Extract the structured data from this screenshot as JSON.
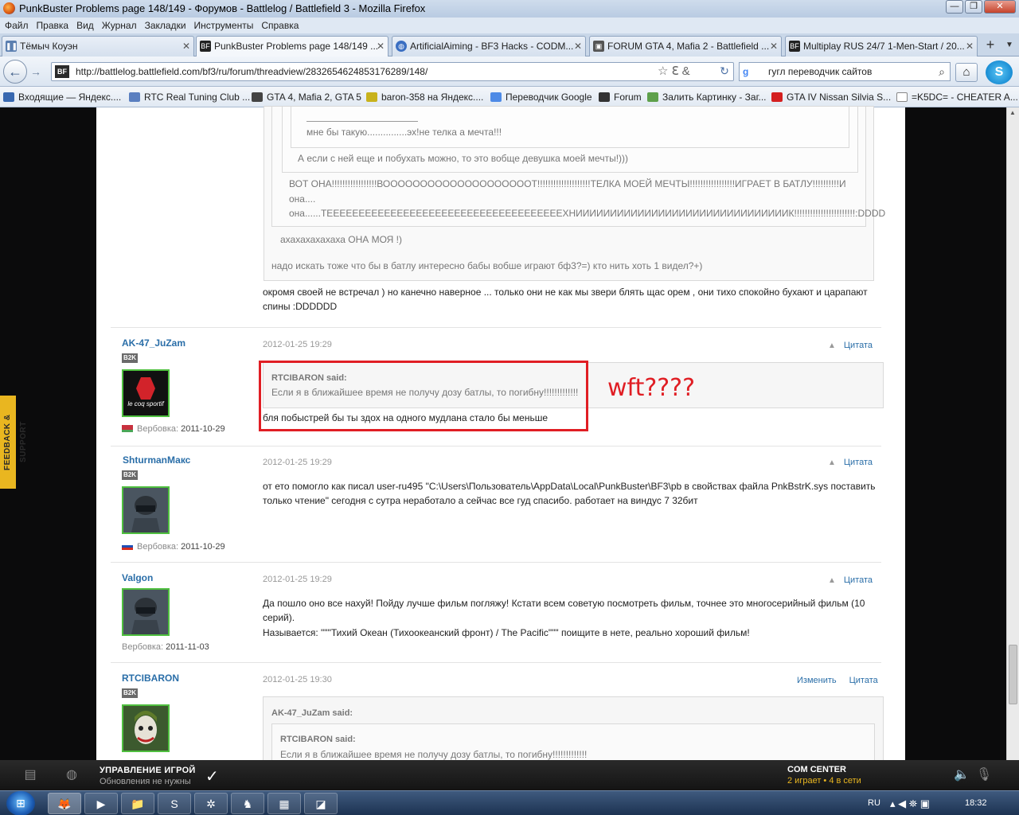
{
  "window": {
    "title": "PunkBuster Problems page 148/149 - Форумов - Battlelog / Battlefield 3 - Mozilla Firefox"
  },
  "menu": [
    "Файл",
    "Правка",
    "Вид",
    "Журнал",
    "Закладки",
    "Инструменты",
    "Справка"
  ],
  "tabs": [
    {
      "label": "Тёмыч Коуэн",
      "icon": "pause-icon"
    },
    {
      "label": "PunkBuster Problems page 148/149 ...",
      "icon": "bf-icon"
    },
    {
      "label": "ArtificialAiming - BF3 Hacks - CODM...",
      "icon": "globe-icon"
    },
    {
      "label": "FORUM GTA 4, Mafia 2 - Battlefield ...",
      "icon": "gta-icon"
    },
    {
      "label": "Multiplay RUS 24/7 1-Men-Start / 20...",
      "icon": "bf-icon"
    }
  ],
  "nav": {
    "url": "http://battlelog.battlefield.com/bf3/ru/forum/threadview/2832654624853176289/148/",
    "search": "гугл переводчик сайтов"
  },
  "bookmarks": [
    "Входящие — Яндекс....",
    "RTC Real Tuning Club ...",
    "GTA 4, Mafia 2, GTA 5",
    "baron-358 на Яндекс....",
    "Переводчик Google",
    "Forum",
    "Залить Картинку - Заг...",
    "GTA IV Nissan Silvia S...",
    "=K5DC= - CHEATER A..."
  ],
  "thread": {
    "q_inner": "мне бы такую...............эх!не телка а мечта!!!",
    "q_mid": "А если с ней еще и побухать можно, то это вобще девушка моей мечты!)))",
    "q_outer1": "ВОТ ОНА!!!!!!!!!!!!!!!!!ВООООООООООООООООООООТ!!!!!!!!!!!!!!!!!!!!ТЕЛКА МОЕЙ МЕЧТЫ!!!!!!!!!!!!!!!!!ИГРАЕТ В БАТЛУ!!!!!!!!!!И",
    "q_outer2": "она....",
    "q_outer3": "она......ТЕЕЕЕЕЕЕЕЕЕЕЕЕЕЕЕЕЕЕЕЕЕЕЕЕЕЕЕЕЕЕЕЕЕЕЕЕХНИИИИИИИИИИИИИИИИИИИИИИИИИИИИИИИК!!!!!!!!!!!!!!!!!!!!!!!:DDDD",
    "q_laugh": "ахахахахахаха ОНА МОЯ !)",
    "q_top": "надо искать тоже что бы в батлу интересно бабы вобше играют бф3?=) кто нить хоть 1 видел?+)",
    "post0_text": "окромя своей не встречал ) но канечно наверное ... только они не как мы звери блять щас орем , они тихо спокойно бухают и царапают спины :DDDDDD"
  },
  "posts": [
    {
      "author": "AK-47_JuZam",
      "badge": "B2K",
      "enlist_label": "Вербовка:",
      "enlist_date": "2011-10-29",
      "date": "2012-01-25 19:29",
      "action": "Цитата",
      "quote_author": "RTCIBARON said:",
      "quote_text": "Если я в ближайшее время не получу дозу батлы, то погибну!!!!!!!!!!!!!",
      "text": "бля побыстрей бы ты здох на одного мудлана стало бы меньше"
    },
    {
      "author": "ShturmanМакс",
      "badge": "B2K",
      "enlist_label": "Вербовка:",
      "enlist_date": "2011-10-29",
      "date": "2012-01-25 19:29",
      "action": "Цитата",
      "text1": "от ето помогло как писал user-ru495 \"C:\\Users\\Пользователь\\AppData\\Local\\PunkBuster\\BF3\\pb в свойствах файла PnkBstrK.sys поставить",
      "text2": "только чтение\" сегодня с сутра неработало а сейчас все гуд спасибо. работает на виндус 7 32бит"
    },
    {
      "author": "Valgon",
      "enlist_label": "Вербовка:",
      "enlist_date": "2011-11-03",
      "date": "2012-01-25 19:29",
      "action": "Цитата",
      "text1": "Да пошло оно все нахуй! Пойду лучше фильм погляжу! Кстати всем советую посмотреть фильм, точнее это многосерийный фильм (10",
      "text2": "серий).",
      "text3": "Называется: \"\"\"Тихий Океан (Тихоокеанский фронт) / The Pacific\"\"\" поищите в нете, реально хороший фильм!"
    },
    {
      "author": "RTCIBARON",
      "badge": "B2K",
      "date": "2012-01-25 19:30",
      "edit": "Изменить",
      "action": "Цитата",
      "quote_author": "AK-47_JuZam said:",
      "inner_author": "RTCIBARON said:",
      "inner_text": "Если я в ближайшее время не получу дозу батлы, то погибну!!!!!!!!!!!!!"
    }
  ],
  "annotation": {
    "text": "wft????",
    "color": "#e01e24"
  },
  "sidebar_tab": "FEEDBACK & SUPPORT",
  "gamebar": {
    "title": "УПРАВЛЕНИЕ ИГРОЙ",
    "subtitle": "Обновления не нужны",
    "com_title": "COM CENTER",
    "com_status": "2 играет • 4 в сети"
  },
  "taskbar": {
    "lang": "RU",
    "time": "18:32"
  },
  "colors": {
    "link": "#2a6ea8",
    "accent_yellow": "#e9b620",
    "avatar_border": "#4fbf3f"
  }
}
